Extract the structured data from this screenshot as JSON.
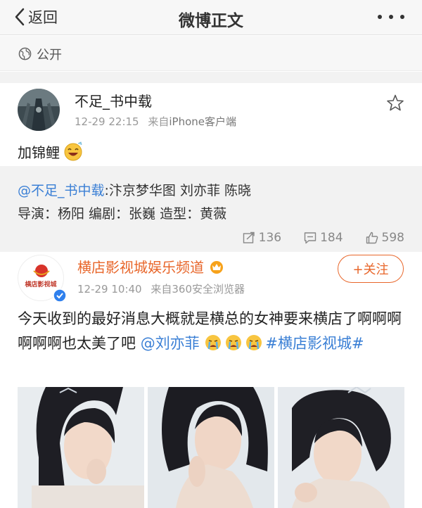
{
  "nav": {
    "back_label": "返回",
    "title": "微博正文"
  },
  "visibility": {
    "label": "公开"
  },
  "post1": {
    "author": "不足_书中载",
    "time": "12-29 22:15",
    "source_prefix": "来自",
    "source": "iPhone客户端",
    "text": "加锦鲤"
  },
  "repost": {
    "mention": "@不足_书中载",
    "line1_rest": ":汴京梦华图 刘亦菲 陈晓",
    "line2": "导演：杨阳 编剧：张巍 造型：黄薇",
    "shares": "136",
    "comments": "184",
    "likes": "598"
  },
  "post2": {
    "author": "横店影视城娱乐频道",
    "avatar_text": "横店影视城",
    "time": "12-29 10:40",
    "source_prefix": "来自",
    "source": "360安全浏览器",
    "follow_label": "+关注",
    "text_a": "今天收到的最好消息大概就是横总的女神要来横店了啊啊啊啊啊啊也太美了吧",
    "mention": "@刘亦菲",
    "tag": "#横店影视城#"
  },
  "colors": {
    "link": "#3a7fd5",
    "orange": "#e8662a",
    "bg": "#f2f2f2"
  }
}
